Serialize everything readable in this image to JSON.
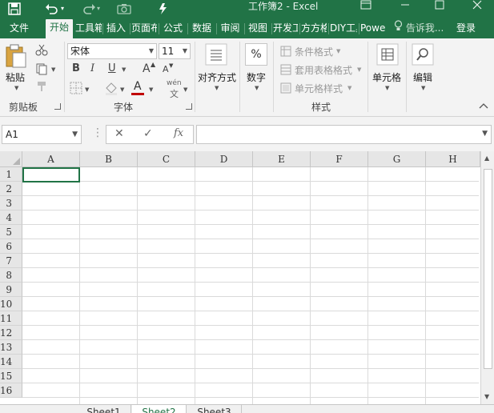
{
  "app": {
    "title": "工作簿2 - Excel",
    "accent_color": "#217346"
  },
  "qat": {
    "save_icon": "save-icon",
    "undo_icon": "undo-icon",
    "redo_icon": "redo-icon",
    "camera_icon": "camera-icon",
    "touch_icon": "touch-mode-icon"
  },
  "window_controls": [
    "ribbon-display-icon",
    "minimize-icon",
    "maximize-icon",
    "close-icon"
  ],
  "tabs": [
    {
      "label": "文件"
    },
    {
      "label": "开始",
      "active": true
    },
    {
      "label": "工具箱"
    },
    {
      "label": "插入"
    },
    {
      "label": "页面布局"
    },
    {
      "label": "公式"
    },
    {
      "label": "数据"
    },
    {
      "label": "审阅"
    },
    {
      "label": "视图"
    },
    {
      "label": "开发工具"
    },
    {
      "label": "方方格子"
    },
    {
      "label": "DIY工具箱"
    },
    {
      "label": "Power Pivot"
    }
  ],
  "tell_me": "告诉我...",
  "login": "登录",
  "ribbon": {
    "clipboard": {
      "label": "剪贴板",
      "paste_label": "粘贴"
    },
    "font": {
      "label": "字体",
      "font_name": "宋体",
      "font_size": "11",
      "bold": "B",
      "italic": "I",
      "underline": "U",
      "grow": "A",
      "shrink": "A",
      "font_color_letter": "A",
      "phonetic": "wén",
      "phonetic_char": "文"
    },
    "alignment": {
      "label": "对齐方式"
    },
    "number": {
      "label": "数字",
      "symbol": "%"
    },
    "styles": {
      "label": "样式",
      "conditional": "条件格式",
      "table_format": "套用表格格式",
      "cell_styles": "单元格样式"
    },
    "cells": {
      "label": "单元格"
    },
    "editing": {
      "label": "编辑"
    }
  },
  "formula_bar": {
    "name_box": "A1",
    "cancel": "✕",
    "enter": "✓",
    "fx": "fx",
    "value": ""
  },
  "grid": {
    "columns": [
      "A",
      "B",
      "C",
      "D",
      "E",
      "F",
      "G",
      "H"
    ],
    "rows": [
      "1",
      "2",
      "3",
      "4",
      "5",
      "6",
      "7",
      "8",
      "9",
      "10",
      "11",
      "12",
      "13",
      "14",
      "15",
      "16"
    ],
    "selected_cell": "A1"
  },
  "sheets": [
    {
      "name": "Sheet1"
    },
    {
      "name": "Sheet2",
      "active": true
    },
    {
      "name": "Sheet3"
    }
  ]
}
